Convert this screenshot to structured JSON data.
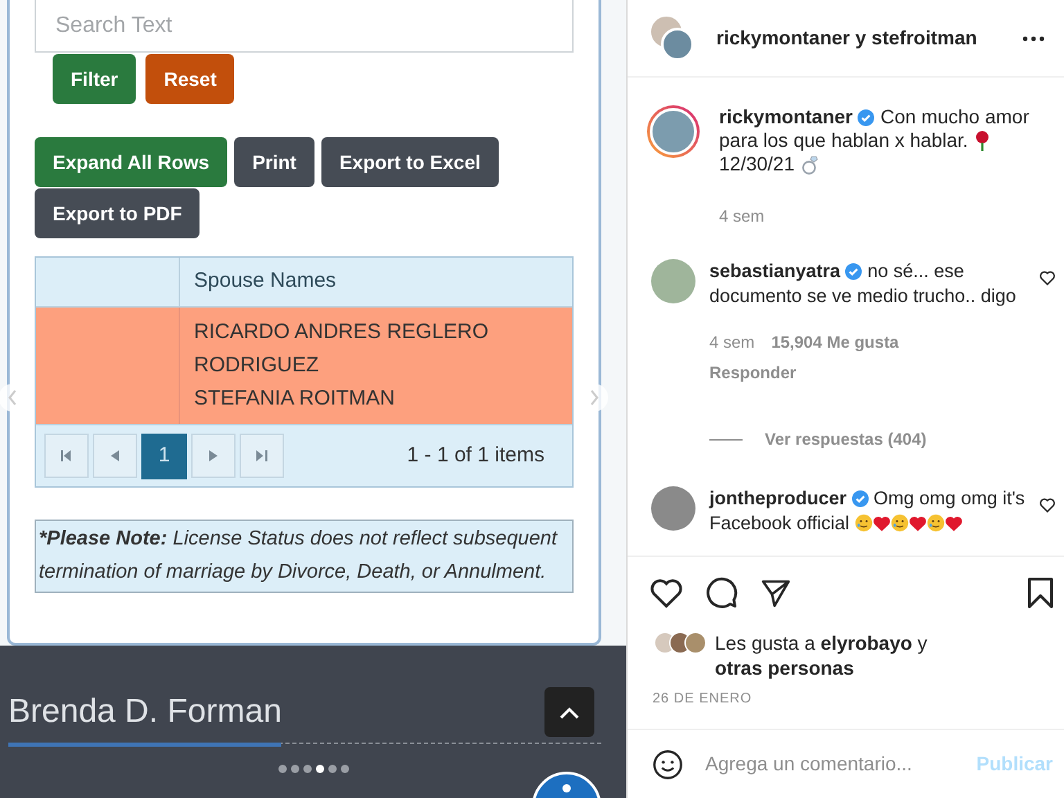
{
  "post_image": {
    "search": {
      "placeholder": "Search Text"
    },
    "filter_buttons": [
      {
        "label": "Filter",
        "kind": "green"
      },
      {
        "label": "Reset",
        "kind": "orange"
      }
    ],
    "action_buttons": [
      {
        "label": "Expand All Rows",
        "kind": "green"
      },
      {
        "label": "Print",
        "kind": "gray"
      },
      {
        "label": "Export to Excel",
        "kind": "gray"
      },
      {
        "label": "Export to PDF",
        "kind": "gray"
      }
    ],
    "table": {
      "columns": [
        "Spouse Names"
      ],
      "rows": [
        {
          "cells": [
            [
              "RICARDO ANDRES REGLERO",
              "RODRIGUEZ",
              "STEFANIA ROITMAN"
            ]
          ],
          "selected": true
        }
      ]
    },
    "pager": {
      "pages": [
        {
          "label": "1",
          "selected": true
        }
      ],
      "summary": "1 - 1 of 1 items"
    },
    "note": {
      "label": "*Please Note:",
      "text": "License Status does not reflect subsequent termination of marriage by Divorce, Death, or Annulment."
    },
    "footer": {
      "name": "Brenda D. Forman",
      "progress": {
        "level": 0.46
      }
    },
    "carousel_dots": [
      {
        "selected": false
      },
      {
        "selected": false
      },
      {
        "selected": false
      },
      {
        "selected": true
      },
      {
        "selected": false
      },
      {
        "selected": false
      }
    ]
  },
  "post": {
    "header": "rickymontaner y stefroitman",
    "caption": {
      "user": "rickymontaner",
      "lines": [
        "Con mucho amor",
        "para los que hablan x hablar.",
        "12/30/21"
      ],
      "time": "4 sem"
    },
    "comments": [
      {
        "user": "sebastianyatra",
        "text": "no sé... ese documento se ve medio trucho.. digo",
        "time": "4 sem",
        "likes": "15,904 Me gusta",
        "reply": "Responder",
        "replies": "Ver respuestas (404)"
      },
      {
        "user": "jontheproducer",
        "text": "Omg omg omg it's Facebook official",
        "emoji": true
      }
    ],
    "likes": {
      "prefix": "Les gusta a ",
      "user": "elyrobayo",
      "suffix": " y",
      "rest": "otras personas"
    },
    "date": "26 DE ENERO",
    "comment_field": {
      "placeholder": "Agrega un comentario...",
      "submit": "Publicar"
    }
  }
}
